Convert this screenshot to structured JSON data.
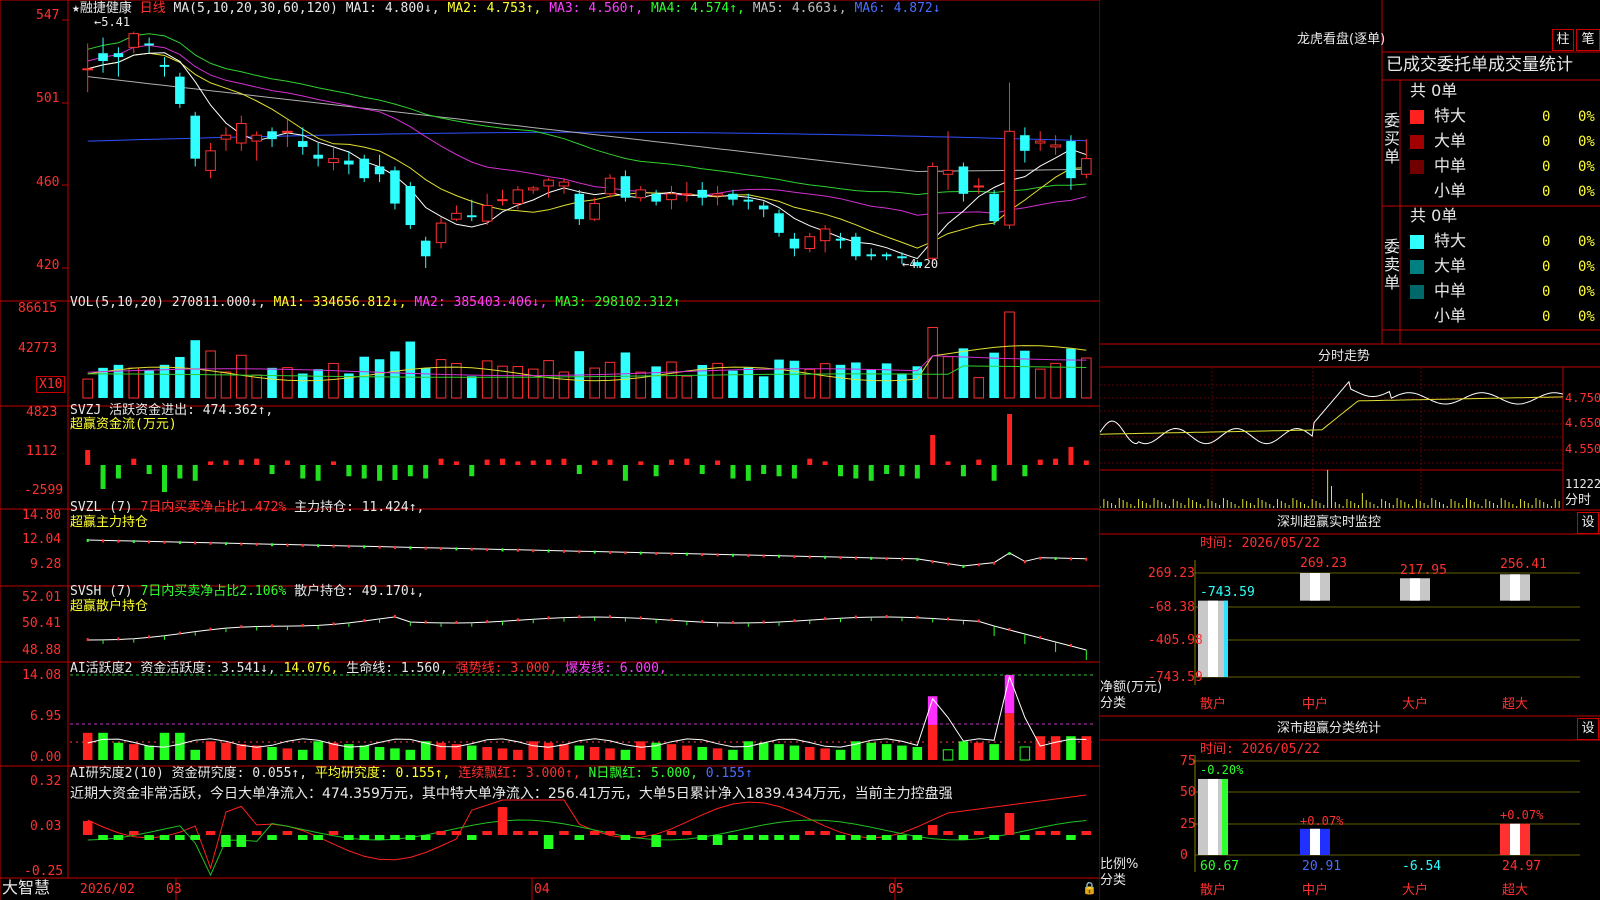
{
  "main_chart": {
    "stock_name": "★融捷健康",
    "period": "日线",
    "ma_header": "MA(5,10,20,30,60,120)",
    "ma1": "MA1: 4.800↓,",
    "ma2": "MA2: 4.753↑,",
    "ma3": "MA3: 4.560↑,",
    "ma4": "MA4: 4.574↑,",
    "ma5": "MA5: 4.663↓,",
    "ma6": "MA6: 4.872↓",
    "y_ticks": [
      "547",
      "501",
      "460",
      "420"
    ],
    "high_mark": "5.41",
    "low_mark": "4.20",
    "candles": [
      {
        "o": 5.22,
        "c": 5.22,
        "h": 5.35,
        "l": 5.1
      },
      {
        "o": 5.3,
        "c": 5.26,
        "h": 5.38,
        "l": 5.2
      },
      {
        "o": 5.3,
        "c": 5.28,
        "h": 5.33,
        "l": 5.18
      },
      {
        "o": 5.33,
        "c": 5.4,
        "h": 5.41,
        "l": 5.3
      },
      {
        "o": 5.35,
        "c": 5.34,
        "h": 5.38,
        "l": 5.3
      },
      {
        "o": 5.24,
        "c": 5.23,
        "h": 5.28,
        "l": 5.18
      },
      {
        "o": 5.18,
        "c": 5.04,
        "h": 5.2,
        "l": 5.02
      },
      {
        "o": 4.98,
        "c": 4.76,
        "h": 5.0,
        "l": 4.72
      },
      {
        "o": 4.7,
        "c": 4.8,
        "h": 4.84,
        "l": 4.66
      },
      {
        "o": 4.86,
        "c": 4.88,
        "h": 4.92,
        "l": 4.8
      },
      {
        "o": 4.84,
        "c": 4.94,
        "h": 4.98,
        "l": 4.8
      },
      {
        "o": 4.85,
        "c": 4.88,
        "h": 4.9,
        "l": 4.75
      },
      {
        "o": 4.9,
        "c": 4.86,
        "h": 4.92,
        "l": 4.82
      },
      {
        "o": 4.9,
        "c": 4.9,
        "h": 4.96,
        "l": 4.82
      },
      {
        "o": 4.85,
        "c": 4.82,
        "h": 4.92,
        "l": 4.78
      },
      {
        "o": 4.78,
        "c": 4.76,
        "h": 4.84,
        "l": 4.72
      },
      {
        "o": 4.74,
        "c": 4.76,
        "h": 4.82,
        "l": 4.7
      },
      {
        "o": 4.75,
        "c": 4.73,
        "h": 4.8,
        "l": 4.68
      },
      {
        "o": 4.76,
        "c": 4.66,
        "h": 4.78,
        "l": 4.64
      },
      {
        "o": 4.72,
        "c": 4.68,
        "h": 4.78,
        "l": 4.64
      },
      {
        "o": 4.7,
        "c": 4.53,
        "h": 4.72,
        "l": 4.5
      },
      {
        "o": 4.62,
        "c": 4.42,
        "h": 4.64,
        "l": 4.4
      },
      {
        "o": 4.34,
        "c": 4.26,
        "h": 4.36,
        "l": 4.2
      },
      {
        "o": 4.33,
        "c": 4.43,
        "h": 4.46,
        "l": 4.3
      },
      {
        "o": 4.45,
        "c": 4.48,
        "h": 4.52,
        "l": 4.44
      },
      {
        "o": 4.47,
        "c": 4.46,
        "h": 4.55,
        "l": 4.44
      },
      {
        "o": 4.44,
        "c": 4.52,
        "h": 4.58,
        "l": 4.42
      },
      {
        "o": 4.55,
        "c": 4.55,
        "h": 4.6,
        "l": 4.52
      },
      {
        "o": 4.53,
        "c": 4.6,
        "h": 4.62,
        "l": 4.5
      },
      {
        "o": 4.6,
        "c": 4.61,
        "h": 4.62,
        "l": 4.58
      },
      {
        "o": 4.62,
        "c": 4.65,
        "h": 4.66,
        "l": 4.56
      },
      {
        "o": 4.62,
        "c": 4.64,
        "h": 4.66,
        "l": 4.58
      },
      {
        "o": 4.58,
        "c": 4.45,
        "h": 4.6,
        "l": 4.42
      },
      {
        "o": 4.45,
        "c": 4.53,
        "h": 4.56,
        "l": 4.44
      },
      {
        "o": 4.58,
        "c": 4.66,
        "h": 4.68,
        "l": 4.56
      },
      {
        "o": 4.67,
        "c": 4.56,
        "h": 4.7,
        "l": 4.54
      },
      {
        "o": 4.56,
        "c": 4.6,
        "h": 4.62,
        "l": 4.54
      },
      {
        "o": 4.58,
        "c": 4.54,
        "h": 4.6,
        "l": 4.52
      },
      {
        "o": 4.55,
        "c": 4.58,
        "h": 4.62,
        "l": 4.5
      },
      {
        "o": 4.58,
        "c": 4.58,
        "h": 4.64,
        "l": 4.54
      },
      {
        "o": 4.6,
        "c": 4.56,
        "h": 4.64,
        "l": 4.52
      },
      {
        "o": 4.57,
        "c": 4.58,
        "h": 4.62,
        "l": 4.52
      },
      {
        "o": 4.58,
        "c": 4.55,
        "h": 4.6,
        "l": 4.52
      },
      {
        "o": 4.55,
        "c": 4.54,
        "h": 4.58,
        "l": 4.5
      },
      {
        "o": 4.52,
        "c": 4.5,
        "h": 4.54,
        "l": 4.46
      },
      {
        "o": 4.48,
        "c": 4.38,
        "h": 4.5,
        "l": 4.36
      },
      {
        "o": 4.35,
        "c": 4.3,
        "h": 4.38,
        "l": 4.26
      },
      {
        "o": 4.3,
        "c": 4.36,
        "h": 4.38,
        "l": 4.28
      },
      {
        "o": 4.34,
        "c": 4.4,
        "h": 4.42,
        "l": 4.28
      },
      {
        "o": 4.35,
        "c": 4.34,
        "h": 4.38,
        "l": 4.3
      },
      {
        "o": 4.36,
        "c": 4.26,
        "h": 4.38,
        "l": 4.24
      },
      {
        "o": 4.27,
        "c": 4.26,
        "h": 4.3,
        "l": 4.24
      },
      {
        "o": 4.27,
        "c": 4.26,
        "h": 4.28,
        "l": 4.24
      },
      {
        "o": 4.26,
        "c": 4.25,
        "h": 4.28,
        "l": 4.22
      },
      {
        "o": 4.23,
        "c": 4.21,
        "h": 4.24,
        "l": 4.2
      },
      {
        "o": 4.25,
        "c": 4.72,
        "h": 4.74,
        "l": 4.22
      },
      {
        "o": 4.68,
        "c": 4.7,
        "h": 4.9,
        "l": 4.6
      },
      {
        "o": 4.72,
        "c": 4.58,
        "h": 4.74,
        "l": 4.54
      },
      {
        "o": 4.62,
        "c": 4.62,
        "h": 4.66,
        "l": 4.58
      },
      {
        "o": 4.58,
        "c": 4.44,
        "h": 4.6,
        "l": 4.42
      },
      {
        "o": 4.42,
        "c": 4.9,
        "h": 5.15,
        "l": 4.4
      },
      {
        "o": 4.88,
        "c": 4.8,
        "h": 4.92,
        "l": 4.74
      },
      {
        "o": 4.84,
        "c": 4.85,
        "h": 4.9,
        "l": 4.8
      },
      {
        "o": 4.82,
        "c": 4.83,
        "h": 4.88,
        "l": 4.78
      },
      {
        "o": 4.85,
        "c": 4.66,
        "h": 4.88,
        "l": 4.6
      },
      {
        "o": 4.68,
        "c": 4.76,
        "h": 4.86,
        "l": 4.66
      }
    ]
  },
  "volume_panel": {
    "title": "VOL(5,10,20)",
    "value": "270811.000↓,",
    "ma1": "MA1: 334656.812↓,",
    "ma2": "MA2: 385403.406↓,",
    "ma3": "MA3: 298102.312↑",
    "y_ticks": [
      "86615",
      "42773"
    ],
    "unit_label": "X10"
  },
  "svzj_panel": {
    "title": "SVZJ",
    "label": "活跃资金进出: 474.362↑,",
    "sub": "超赢资金流(万元)",
    "y_ticks": [
      "4823",
      "1112",
      "-2599"
    ]
  },
  "svzl_panel": {
    "title": "SVZL (7)",
    "ratio": "7日内买卖净占比1.472%",
    "holding": "主力持仓: 11.424↑,",
    "sub": "超赢主力持仓",
    "y_ticks": [
      "14.80",
      "12.04",
      "9.28"
    ]
  },
  "svsh_panel": {
    "title": "SVSH (7)",
    "ratio": "7日内买卖净占比2.106%",
    "holding": "散户持仓: 49.170↓,",
    "sub": "超赢散户持仓",
    "y_ticks": [
      "52.01",
      "50.41",
      "48.88"
    ]
  },
  "ai_activity_panel": {
    "title": "AI活跃度2",
    "a": "资金活跃度: 3.541↓,",
    "b": "14.076,",
    "c": "生命线: 1.560,",
    "d": "强势线: 3.000,",
    "e": "爆发线: 6.000,",
    "y_ticks": [
      "14.08",
      "6.95",
      "0.00"
    ]
  },
  "ai_research_panel": {
    "title": "AI研究度2(10)",
    "a": "资金研究度: 0.055↑,",
    "b": "平均研究度: 0.155↑,",
    "c": "连续飘红: 3.000↑,",
    "d": "N日飘红: 5.000,",
    "e": "0.155↑",
    "comment": "近期大资金非常活跃，今日大单净流入：474.359万元，其中特大单净流入：256.41万元，大单5日累计净入1839.434万元，当前主力控盘强",
    "y_ticks": [
      "0.32",
      "0.03",
      "-0.25"
    ]
  },
  "bottom_axis": {
    "brand": "大智慧",
    "dates": [
      "2026/02",
      "03",
      "04",
      "05"
    ]
  },
  "dragon_tiger": {
    "title": "龙虎看盘(逐单)",
    "btn_bar": "柱",
    "btn_stroke": "笔",
    "header": "已成交委托单成交量统计",
    "buy_total": "共 0单",
    "buy_label": "委买单",
    "sell_total": "共 0单",
    "sell_label": "委卖单",
    "buy_rows": [
      {
        "name": "特大",
        "count": "0",
        "pct": "0%",
        "color": "#ff2020"
      },
      {
        "name": "大单",
        "count": "0",
        "pct": "0%",
        "color": "#a00000"
      },
      {
        "name": "中单",
        "count": "0",
        "pct": "0%",
        "color": "#700000"
      },
      {
        "name": "小单",
        "count": "0",
        "pct": "0%",
        "color": "#000000"
      }
    ],
    "sell_rows": [
      {
        "name": "特大",
        "count": "0",
        "pct": "0%",
        "color": "#30ffff"
      },
      {
        "name": "大单",
        "count": "0",
        "pct": "0%",
        "color": "#008080"
      },
      {
        "name": "中单",
        "count": "0",
        "pct": "0%",
        "color": "#006868"
      },
      {
        "name": "小单",
        "count": "0",
        "pct": "0%",
        "color": "#000000"
      }
    ]
  },
  "intraday": {
    "title": "分时走势",
    "price_ticks": [
      "4.750",
      "4.650",
      "4.550"
    ],
    "vol_tick": "11222",
    "label": "分时"
  },
  "sz_monitor": {
    "title": "深圳超赢实时监控",
    "settings": "设",
    "time": "时间: 2026/05/22",
    "y_ticks": [
      "269.23",
      "-68.38",
      "-405.98",
      "-743.59"
    ],
    "y_label": "净额(万元)",
    "x_label": "分类",
    "categories": [
      "散户",
      "中户",
      "大户",
      "超大"
    ],
    "values": [
      -743.59,
      269.23,
      217.95,
      256.41
    ],
    "value_labels": [
      "-743.59",
      "269.23",
      "217.95",
      "256.41"
    ]
  },
  "sz_classify": {
    "title": "深市超赢分类统计",
    "settings": "设",
    "time": "时间: 2026/05/22",
    "y_ticks": [
      "75",
      "50",
      "25",
      "0"
    ],
    "y_label": "比例%",
    "x_label": "分类",
    "categories": [
      "散户",
      "中户",
      "大户",
      "超大"
    ],
    "values": [
      60.67,
      20.91,
      -6.54,
      24.97
    ],
    "value_labels": [
      "60.67",
      "20.91",
      "-6.54",
      "24.97"
    ],
    "change_labels": [
      "-0.20%",
      "+0.07%",
      "",
      "+0.07%"
    ]
  }
}
